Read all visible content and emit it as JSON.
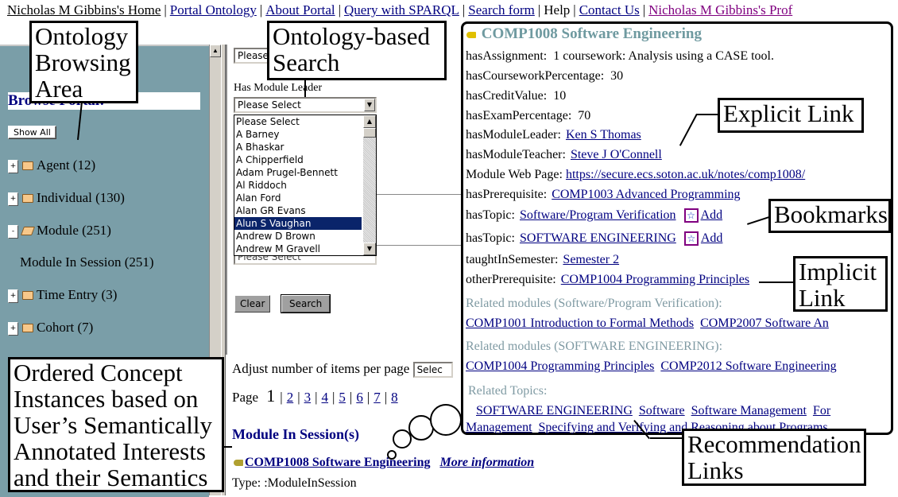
{
  "nav": {
    "items": [
      {
        "label": "Nicholas M Gibbins's Home",
        "style": "home"
      },
      {
        "label": "Portal Ontology",
        "style": "link"
      },
      {
        "label": "About Portal",
        "style": "link"
      },
      {
        "label": "Query with SPARQL",
        "style": "link"
      },
      {
        "label": "Search form",
        "style": "link"
      },
      {
        "label": "Help",
        "style": "plain"
      },
      {
        "label": "Contact Us",
        "style": "link"
      },
      {
        "label": "Nicholas M Gibbins's Prof",
        "style": "visited"
      }
    ],
    "separator": "|"
  },
  "sidebar": {
    "title": "Browse Portal:",
    "show_all": "Show All",
    "tree": [
      {
        "toggle": "+",
        "label": "Agent (12)",
        "folder": "closed"
      },
      {
        "toggle": "+",
        "label": "Individual (130)",
        "folder": "closed"
      },
      {
        "toggle": "-",
        "label": "Module (251)",
        "folder": "open"
      },
      {
        "toggle": "",
        "label": "Module In Session (251)",
        "folder": "none"
      },
      {
        "toggle": "+",
        "label": "Time Entry (3)",
        "folder": "closed"
      },
      {
        "toggle": "+",
        "label": "Cohort (7)",
        "folder": "closed"
      }
    ]
  },
  "search": {
    "top_select_value": "Please Select",
    "leader_label": "Has Module Leader",
    "leader_value": "Please Select",
    "leader_options": [
      "Please Select",
      "A Barney",
      "A Bhaskar",
      "A Chipperfield",
      "Adam Prugel-Bennett",
      "Al Riddoch",
      "Alan Ford",
      "Alan GR Evans",
      "Alun S Vaughan",
      "Andrew D Brown",
      "Andrew M Gravell"
    ],
    "highlighted_option": "Alun S Vaughan",
    "hidden_select_value": "Please Select",
    "clear_label": "Clear",
    "search_label": "Search"
  },
  "results": {
    "per_page_label": "Adjust number of items per page",
    "per_page_value": "Selec",
    "page_label": "Page",
    "current_page": "1",
    "pages": [
      "2",
      "3",
      "4",
      "5",
      "6",
      "7",
      "8"
    ],
    "section_title": "Module In Session(s)",
    "item_title": "COMP1008 Software Engineering",
    "more_info": "More information",
    "item_type": "Type: :ModuleInSession"
  },
  "detail": {
    "title": "COMP1008 Software Engineering",
    "assignment": {
      "key": "hasAssignment:",
      "value": "1 coursework: Analysis using a CASE tool."
    },
    "coursework": {
      "key": "hasCourseworkPercentage:",
      "value": "30"
    },
    "credit": {
      "key": "hasCreditValue:",
      "value": "10"
    },
    "exam": {
      "key": "hasExamPercentage:",
      "value": "70"
    },
    "leader": {
      "key": "hasModuleLeader:",
      "value": "Ken S Thomas"
    },
    "teacher": {
      "key": "hasModuleTeacher:",
      "value": "Steve J O'Connell"
    },
    "webpage": {
      "key": "Module Web Page:",
      "value": "https://secure.ecs.soton.ac.uk/notes/comp1008/"
    },
    "prereq": {
      "key": "hasPrerequisite:",
      "value": "COMP1003 Advanced Programming"
    },
    "topic1": {
      "key": "hasTopic:",
      "value": "Software/Program Verification",
      "add": "Add"
    },
    "topic2": {
      "key": "hasTopic:",
      "value": "SOFTWARE ENGINEERING",
      "add": "Add"
    },
    "semester": {
      "key": "taughtInSemester:",
      "value": "Semester 2"
    },
    "other_prereq": {
      "key": "otherPrerequisite:",
      "value": "COMP1004 Programming Principles"
    },
    "related1_label": "Related modules (Software/Program Verification):",
    "related1": [
      "COMP1001 Introduction to Formal Methods",
      "COMP2007 Software An"
    ],
    "related2_label": "Related modules (SOFTWARE ENGINEERING):",
    "related2": [
      "COMP1004 Programming Principles",
      "COMP2012 Software Engineering"
    ],
    "topics_label": "Related Topics:",
    "topics_line1": [
      "SOFTWARE ENGINEERING",
      "Software",
      "Software Management",
      "For"
    ],
    "topics_line2": [
      "Management",
      "Specifying and Verifying and Reasoning about Programs"
    ]
  },
  "callouts": {
    "browsing": "Ontology Browsing Area",
    "search": "Ontology-based Search",
    "explicit": "Explicit Link",
    "bookmarks": "Bookmarks",
    "implicit": "Implicit Link",
    "ordered": "Ordered Concept Instances based on User’s Semantically Annotated Interests and their Semantics",
    "recommendation": "Recommendation Links"
  }
}
